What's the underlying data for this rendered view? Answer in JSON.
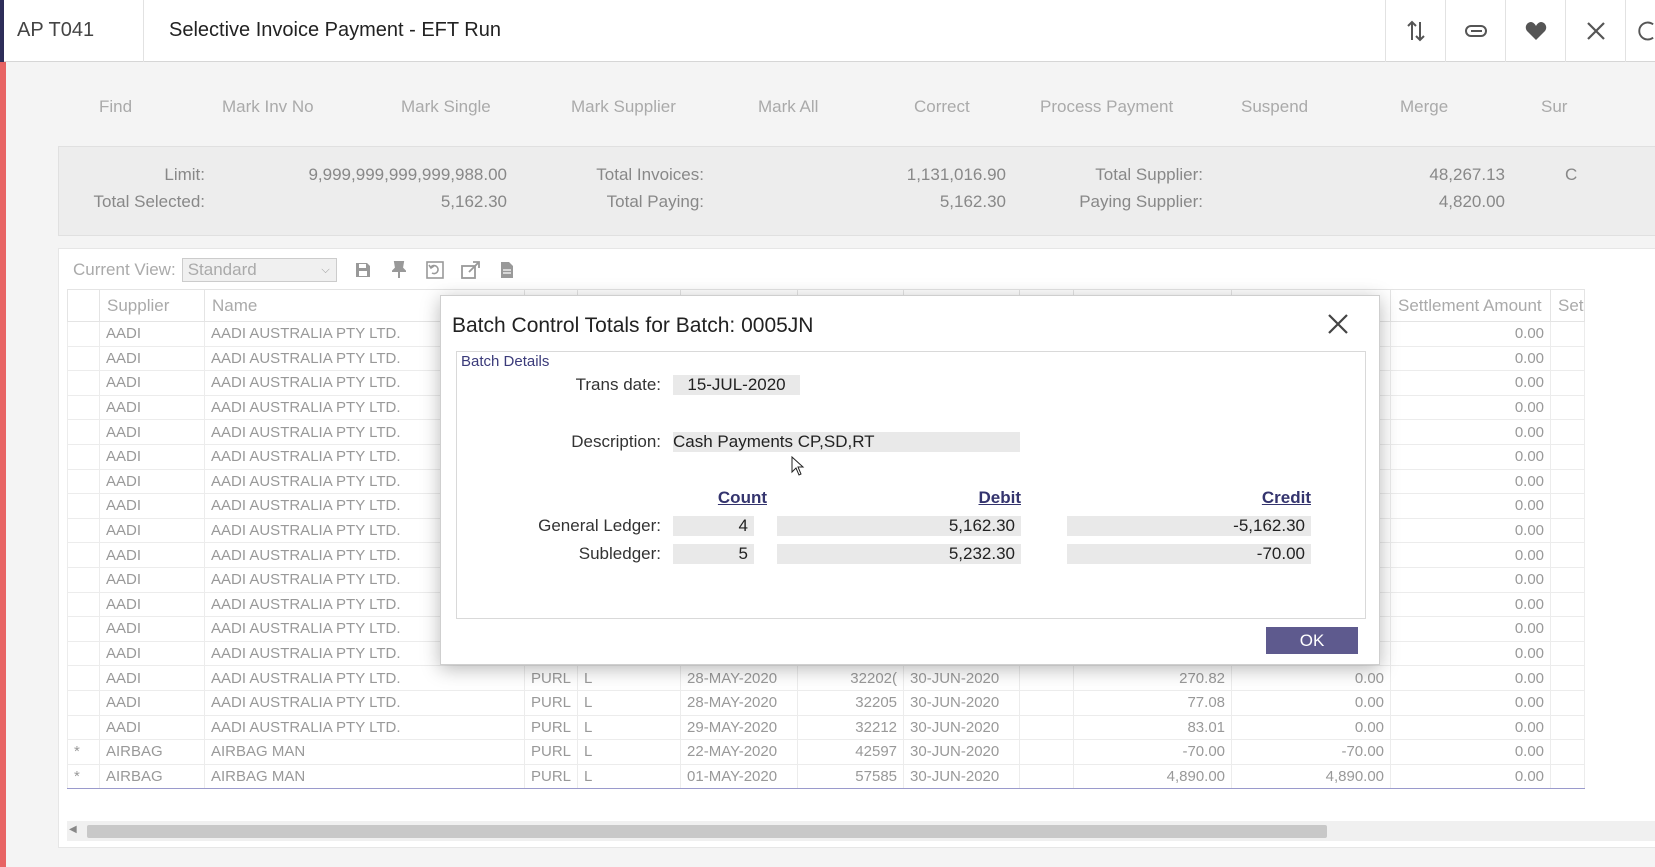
{
  "header": {
    "app_code": "AP T041",
    "title": "Selective Invoice Payment - EFT Run",
    "icons": [
      "sort-icon",
      "paperclip-icon",
      "heart-icon",
      "close-icon",
      "refresh-icon"
    ]
  },
  "toolbar": {
    "items": [
      "Find",
      "Mark Inv No",
      "Mark Single",
      "Mark Supplier",
      "Mark All",
      "Correct",
      "Process Payment",
      "Suspend",
      "Merge",
      "Sur"
    ]
  },
  "totals": {
    "limit_label": "Limit:",
    "limit_value": "9,999,999,999,999,988.00",
    "total_selected_label": "Total Selected:",
    "total_selected_value": "5,162.30",
    "total_invoices_label": "Total Invoices:",
    "total_invoices_value": "1,131,016.90",
    "total_paying_label": "Total Paying:",
    "total_paying_value": "5,162.30",
    "total_supplier_label": "Total Supplier:",
    "total_supplier_value": "48,267.13",
    "paying_supplier_label": "Paying Supplier:",
    "paying_supplier_value": "4,820.00",
    "cut_char": "C"
  },
  "grid": {
    "current_view_label": "Current View:",
    "current_view_value": "Standard",
    "columns": {
      "supplier": "Supplier",
      "name": "Name",
      "settlement_amount": "Settlement Amount",
      "se_partial": "Set"
    },
    "rows": [
      {
        "flag": "",
        "supplier": "AADI",
        "name": "AADI  AUSTRALIA  PTY LTD.",
        "c1": "",
        "c2": "",
        "inv_date": "",
        "inv_no": "",
        "due_date": "",
        "c7": "",
        "amount": "",
        "paying": "",
        "settlement": "0.00"
      },
      {
        "flag": "",
        "supplier": "AADI",
        "name": "AADI  AUSTRALIA  PTY LTD.",
        "c1": "",
        "c2": "",
        "inv_date": "",
        "inv_no": "",
        "due_date": "",
        "c7": "",
        "amount": "",
        "paying": "",
        "settlement": "0.00"
      },
      {
        "flag": "",
        "supplier": "AADI",
        "name": "AADI  AUSTRALIA  PTY LTD.",
        "c1": "",
        "c2": "",
        "inv_date": "",
        "inv_no": "",
        "due_date": "",
        "c7": "",
        "amount": "",
        "paying": "",
        "settlement": "0.00"
      },
      {
        "flag": "",
        "supplier": "AADI",
        "name": "AADI  AUSTRALIA  PTY LTD.",
        "c1": "",
        "c2": "",
        "inv_date": "",
        "inv_no": "",
        "due_date": "",
        "c7": "",
        "amount": "",
        "paying": "",
        "settlement": "0.00"
      },
      {
        "flag": "",
        "supplier": "AADI",
        "name": "AADI  AUSTRALIA  PTY LTD.",
        "c1": "",
        "c2": "",
        "inv_date": "",
        "inv_no": "",
        "due_date": "",
        "c7": "",
        "amount": "",
        "paying": "",
        "settlement": "0.00"
      },
      {
        "flag": "",
        "supplier": "AADI",
        "name": "AADI  AUSTRALIA  PTY LTD.",
        "c1": "",
        "c2": "",
        "inv_date": "",
        "inv_no": "",
        "due_date": "",
        "c7": "",
        "amount": "",
        "paying": "",
        "settlement": "0.00"
      },
      {
        "flag": "",
        "supplier": "AADI",
        "name": "AADI  AUSTRALIA  PTY LTD.",
        "c1": "",
        "c2": "",
        "inv_date": "",
        "inv_no": "",
        "due_date": "",
        "c7": "",
        "amount": "",
        "paying": "",
        "settlement": "0.00"
      },
      {
        "flag": "",
        "supplier": "AADI",
        "name": "AADI  AUSTRALIA  PTY LTD.",
        "c1": "",
        "c2": "",
        "inv_date": "",
        "inv_no": "",
        "due_date": "",
        "c7": "",
        "amount": "",
        "paying": "",
        "settlement": "0.00"
      },
      {
        "flag": "",
        "supplier": "AADI",
        "name": "AADI  AUSTRALIA  PTY LTD.",
        "c1": "",
        "c2": "",
        "inv_date": "",
        "inv_no": "",
        "due_date": "",
        "c7": "",
        "amount": "",
        "paying": "",
        "settlement": "0.00"
      },
      {
        "flag": "",
        "supplier": "AADI",
        "name": "AADI  AUSTRALIA  PTY LTD.",
        "c1": "",
        "c2": "",
        "inv_date": "",
        "inv_no": "",
        "due_date": "",
        "c7": "",
        "amount": "",
        "paying": "",
        "settlement": "0.00"
      },
      {
        "flag": "",
        "supplier": "AADI",
        "name": "AADI  AUSTRALIA  PTY LTD.",
        "c1": "",
        "c2": "",
        "inv_date": "",
        "inv_no": "",
        "due_date": "",
        "c7": "",
        "amount": "",
        "paying": "",
        "settlement": "0.00"
      },
      {
        "flag": "",
        "supplier": "AADI",
        "name": "AADI  AUSTRALIA  PTY LTD.",
        "c1": "",
        "c2": "",
        "inv_date": "",
        "inv_no": "",
        "due_date": "",
        "c7": "",
        "amount": "",
        "paying": "",
        "settlement": "0.00"
      },
      {
        "flag": "",
        "supplier": "AADI",
        "name": "AADI  AUSTRALIA  PTY LTD.",
        "c1": "",
        "c2": "",
        "inv_date": "",
        "inv_no": "",
        "due_date": "",
        "c7": "",
        "amount": "",
        "paying": "",
        "settlement": "0.00"
      },
      {
        "flag": "",
        "supplier": "AADI",
        "name": "AADI  AUSTRALIA  PTY LTD.",
        "c1": "",
        "c2": "",
        "inv_date": "",
        "inv_no": "",
        "due_date": "",
        "c7": "",
        "amount": "",
        "paying": "",
        "settlement": "0.00"
      },
      {
        "flag": "",
        "supplier": "AADI",
        "name": "AADI  AUSTRALIA  PTY LTD.",
        "c1": "PURL",
        "c2": "L",
        "inv_date": "28-MAY-2020",
        "inv_no": "32202(",
        "due_date": "30-JUN-2020",
        "c7": "",
        "amount": "270.82",
        "paying": "0.00",
        "settlement": "0.00"
      },
      {
        "flag": "",
        "supplier": "AADI",
        "name": "AADI  AUSTRALIA  PTY LTD.",
        "c1": "PURL",
        "c2": "L",
        "inv_date": "28-MAY-2020",
        "inv_no": "32205",
        "due_date": "30-JUN-2020",
        "c7": "",
        "amount": "77.08",
        "paying": "0.00",
        "settlement": "0.00"
      },
      {
        "flag": "",
        "supplier": "AADI",
        "name": "AADI  AUSTRALIA  PTY LTD.",
        "c1": "PURL",
        "c2": "L",
        "inv_date": "29-MAY-2020",
        "inv_no": "32212",
        "due_date": "30-JUN-2020",
        "c7": "",
        "amount": "83.01",
        "paying": "0.00",
        "settlement": "0.00"
      },
      {
        "flag": "*",
        "supplier": "AIRBAG",
        "name": "AIRBAG MAN",
        "c1": "PURL",
        "c2": "L",
        "inv_date": "22-MAY-2020",
        "inv_no": "42597",
        "due_date": "30-JUN-2020",
        "c7": "",
        "amount": "-70.00",
        "paying": "-70.00",
        "settlement": "0.00"
      },
      {
        "flag": "*",
        "supplier": "AIRBAG",
        "name": "AIRBAG MAN",
        "c1": "PURL",
        "c2": "L",
        "inv_date": "01-MAY-2020",
        "inv_no": "57585",
        "due_date": "30-JUN-2020",
        "c7": "",
        "amount": "4,890.00",
        "paying": "4,890.00",
        "settlement": "0.00"
      }
    ]
  },
  "modal": {
    "title": "Batch Control Totals for Batch: 0005JN",
    "section": "Batch Details",
    "trans_date_label": "Trans date:",
    "trans_date_value": "15-JUL-2020",
    "description_label": "Description:",
    "description_value": "Cash Payments  CP,SD,RT",
    "count_header": "Count",
    "debit_header": "Debit",
    "credit_header": "Credit",
    "gl_label": "General Ledger:",
    "gl_count": "4",
    "gl_debit": "5,162.30",
    "gl_credit": "-5,162.30",
    "sl_label": "Subledger:",
    "sl_count": "5",
    "sl_debit": "5,232.30",
    "sl_credit": "-70.00",
    "ok_label": "OK"
  },
  "colors": {
    "accent_red": "#e86464",
    "modal_label_blue": "#34346e",
    "ok_button": "#5e5a8e"
  }
}
